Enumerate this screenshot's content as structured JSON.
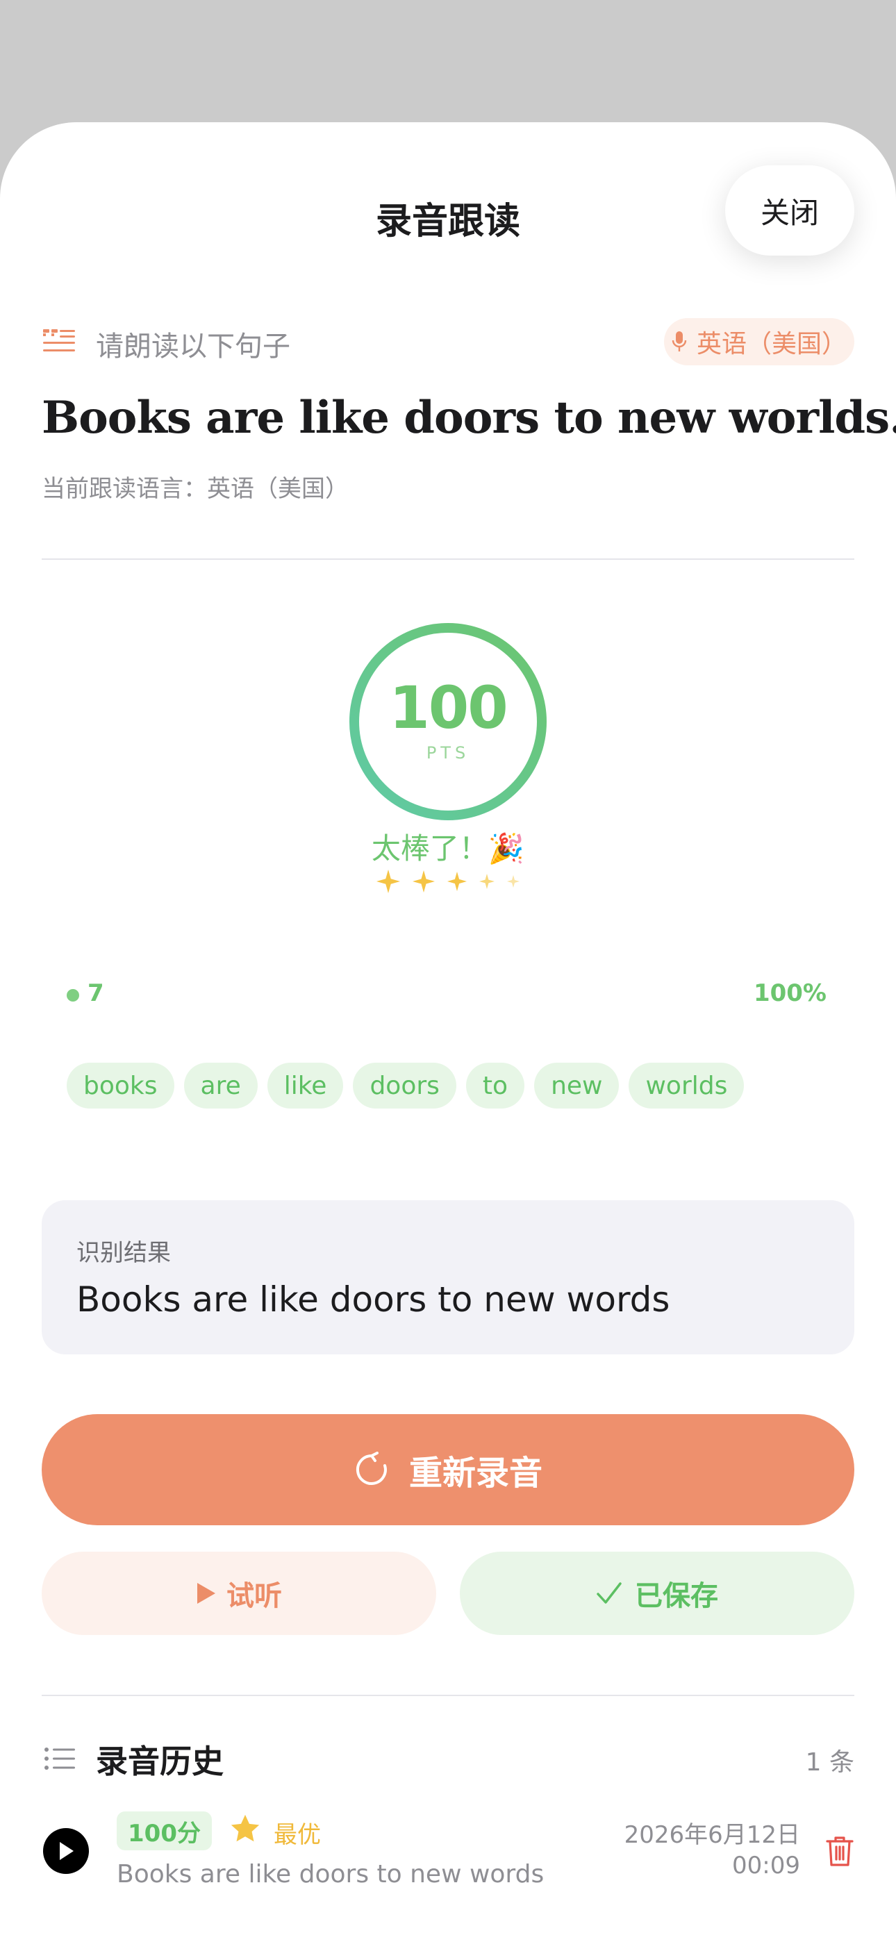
{
  "header": {
    "title": "录音跟读",
    "close_label": "关闭"
  },
  "prompt": {
    "label": "请朗读以下句子",
    "language_badge": "英语（美国）",
    "sentence": "Books are like doors to new worlds.",
    "current_language": "当前跟读语言：英语（美国）"
  },
  "score": {
    "value": "100",
    "unit": "PTS",
    "ring_fraction": 1.0,
    "praise": "太棒了！🎉",
    "stars_shown": 5
  },
  "words": {
    "count": "7",
    "accuracy": "100%",
    "items": [
      "books",
      "are",
      "like",
      "doors",
      "to",
      "new",
      "worlds"
    ]
  },
  "recognition": {
    "label": "识别结果",
    "text": "Books are like doors to new words"
  },
  "actions": {
    "rerecord_label": "重新录音",
    "listen_label": "试听",
    "saved_label": "已保存"
  },
  "history": {
    "title": "录音历史",
    "count": "1 条",
    "entries": [
      {
        "score": "100分",
        "badge": "最优",
        "text": "Books are like doors to new words",
        "date": "2026年6月12日",
        "time": "00:09"
      }
    ]
  },
  "colors": {
    "accent": "#ee906d",
    "success": "#6cc56f",
    "star": "#f5c445",
    "danger": "#e5534b"
  },
  "icons": {
    "prompt": "quote-lines-icon",
    "language": "microphone-icon",
    "rerecord": "refresh-icon",
    "listen": "play-icon",
    "saved": "checkmark-icon",
    "history": "list-icon",
    "history_play": "play-circle-icon",
    "history_best": "star-icon",
    "history_delete": "trash-icon"
  }
}
